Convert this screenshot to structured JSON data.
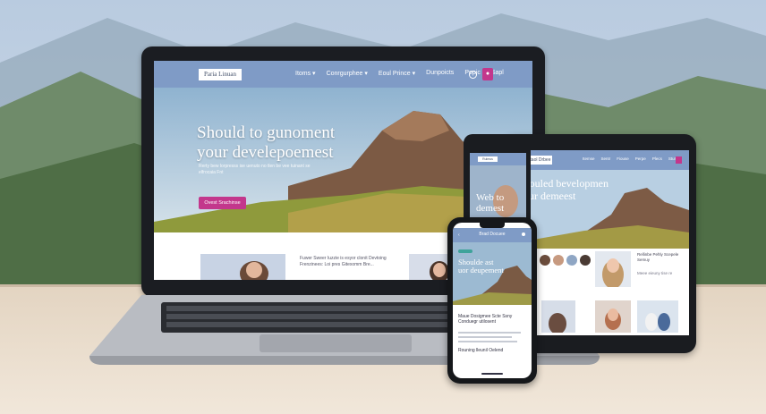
{
  "laptop": {
    "logo": "Paria Linuan",
    "menu": [
      "Itoms ▾",
      "Conrgurphee ▾",
      "Eoul Prince ▾",
      "Dunpoicts",
      "Popic",
      "Sapl"
    ],
    "hero_title_line1": "Should to gunoment",
    "hero_title_line2": "your develepoemest",
    "hero_sub": "Rerty bew lorpresss ise uenuto no tlen be vee tuinant se elfrocaia Fnt",
    "cta": "Ovest Srachinse",
    "card_text": "Fuwer Sweer Iuzzie is esyor clonit Devtoing Frenzinees: Loi pres Gitexomm Bre..."
  },
  "tablet": {
    "logo": "Gtaol Drbee",
    "menu": [
      "Itemse",
      "Sentr",
      "Fiouse",
      "Perpe",
      "Plecs",
      "Stur"
    ],
    "hero_title_line1": "Shouled bevelopmen",
    "hero_title_line2": "your demeest",
    "side_title": "Rellinbe Pehly Scepele Semuy",
    "side_text": "Meee eieuny tise re"
  },
  "phone_back": {
    "logo": "Rulmus",
    "hero_title_line1": "Web to",
    "hero_title_line2": "demest"
  },
  "phone_front": {
    "title": "Brad Docuee",
    "hero_title_line1": "Shoulde ast",
    "hero_title_line2": "uor deupement",
    "body_text": "Maue Dosigmee Scte Ssny Conduegr utilosent",
    "footer": "Rouning lleunil Oelend"
  },
  "colors": {
    "nav_blue": "#7f9bc6",
    "accent_magenta": "#c3378c",
    "teal_tag": "#3ea39a"
  }
}
